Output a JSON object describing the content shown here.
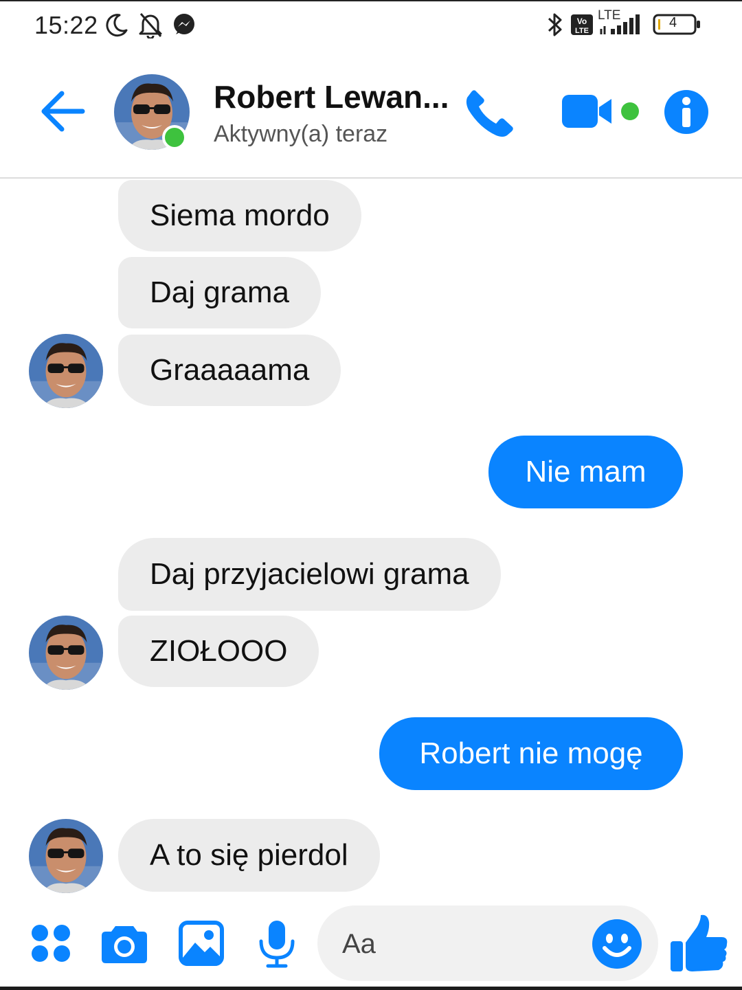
{
  "status_bar": {
    "time": "15:22",
    "network": "LTE",
    "battery": "4"
  },
  "header": {
    "contact_name": "Robert Lewan...",
    "contact_status": "Aktywny(a) teraz"
  },
  "messages": [
    {
      "direction": "incoming",
      "text": "Siema mordo"
    },
    {
      "direction": "incoming",
      "text": "Daj grama"
    },
    {
      "direction": "incoming",
      "text": "Graaaaama"
    },
    {
      "direction": "outgoing",
      "text": "Nie mam"
    },
    {
      "direction": "incoming",
      "text": "Daj przyjacielowi grama"
    },
    {
      "direction": "incoming",
      "text": "ZIOŁOOO"
    },
    {
      "direction": "outgoing",
      "text": "Robert nie mogę"
    },
    {
      "direction": "incoming",
      "text": "A to się pierdol"
    }
  ],
  "composer": {
    "placeholder": "Aa"
  },
  "colors": {
    "accent": "#0a84ff",
    "incoming_bubble": "#ececec",
    "online": "#3ec23e"
  },
  "icons": {
    "back": "arrow-left-icon",
    "call": "phone-icon",
    "video": "video-camera-icon",
    "info": "info-icon",
    "apps": "four-dots-icon",
    "camera": "camera-icon",
    "gallery": "image-icon",
    "mic": "microphone-icon",
    "emoji": "smiley-icon",
    "like": "thumbs-up-icon"
  }
}
